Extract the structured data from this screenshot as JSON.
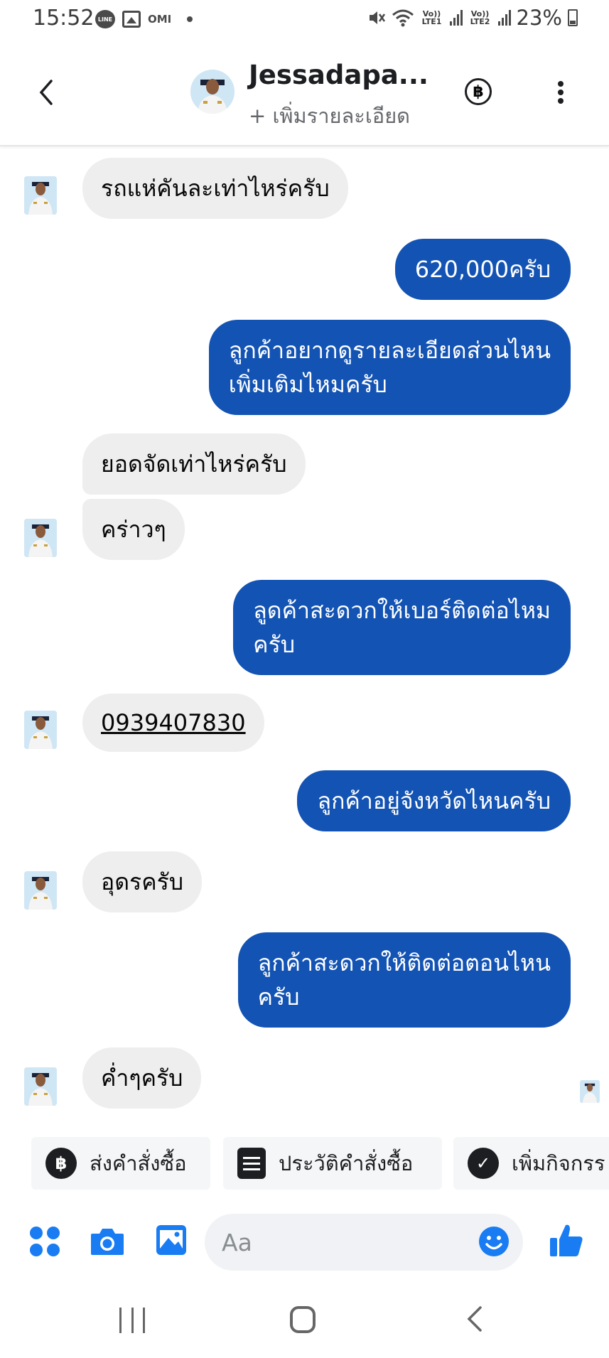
{
  "status_bar": {
    "time": "15:52",
    "line_badge": "LINE",
    "omi_label": "OMI",
    "sim1": "Vo)) LTE1",
    "sim2": "Vo)) LTE2",
    "battery": "23%"
  },
  "header": {
    "name": "Jessadapa...",
    "subtitle": "+ เพิ่มรายละเอียด",
    "baht_symbol": "฿"
  },
  "messages": [
    {
      "from": "contact",
      "text": "รถแห่คันละเท่าไหร่ครับ"
    },
    {
      "from": "me",
      "text": "620,000ครับ"
    },
    {
      "from": "me",
      "lines": [
        "ลูกค้าอยากดูรายละเอียดส่วนไหน",
        "เพิ่มเติมไหมครับ"
      ]
    },
    {
      "from": "contact",
      "text": "ยอดจัดเท่าไหร่ครับ"
    },
    {
      "from": "contact",
      "text": "คร่าวๆ"
    },
    {
      "from": "me",
      "lines": [
        "ลูดค้าสะดวกให้เบอร์ติดต่อไหม",
        "ครับ"
      ]
    },
    {
      "from": "contact",
      "text": "0939407830"
    },
    {
      "from": "me",
      "text": "ลูกค้าอยู่จังหวัดไหนครับ"
    },
    {
      "from": "contact",
      "text": "อุดรครับ"
    },
    {
      "from": "me",
      "lines": [
        "ลูกค้าสะดวกให้ติดต่อตอนไหน",
        "ครับ"
      ]
    },
    {
      "from": "contact",
      "text": "ค่ำๆครับ"
    }
  ],
  "quick_actions": [
    {
      "label": "ส่งคำสั่งซื้อ",
      "icon": "baht-circle-icon",
      "symbol": "฿"
    },
    {
      "label": "ประวัติคำสั่งซื้อ",
      "icon": "order-history-icon"
    },
    {
      "label": "เพิ่มกิจกรร",
      "icon": "check-circle-icon",
      "symbol": "✓"
    }
  ],
  "composer": {
    "placeholder": "Aa"
  },
  "colors": {
    "outgoing_bubble": "#1353b3",
    "incoming_bubble": "#eeeeee",
    "accent": "#1a7cf2"
  }
}
